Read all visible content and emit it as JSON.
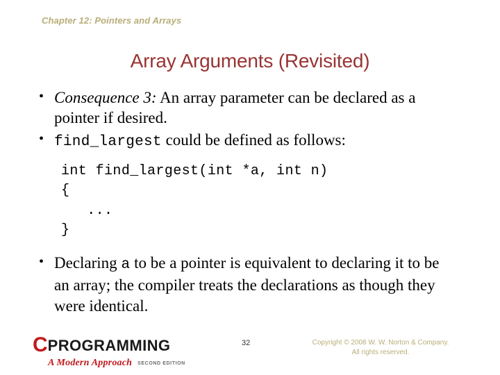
{
  "header": {
    "chapter": "Chapter 12: Pointers and Arrays",
    "chapter_color": "#b8ae78"
  },
  "title": {
    "text": "Array Arguments (Revisited)",
    "color": "#993333"
  },
  "body": {
    "bullet_glyph": "•",
    "bullets": [
      {
        "id": "consequence-3",
        "emphasis": "Consequence 3:",
        "text": " An array parameter can be declared as a pointer if desired."
      },
      {
        "id": "find-largest-intro",
        "code_term": "find_largest",
        "text": " could be defined as follows:"
      },
      {
        "id": "declaring-equivalence",
        "lead": "Declaring ",
        "code_term": "a",
        "text": " to be a pointer is equivalent to declaring it to be an array; the compiler treats the declarations as though they were identical."
      }
    ],
    "code": "int find_largest(int *a, int n)\n{\n   ...\n}"
  },
  "footer": {
    "logo": {
      "letter": "C",
      "word": "PROGRAMMING",
      "tagline": "A Modern Approach",
      "edition": "SECOND EDITION",
      "letter_color": "#c0191b",
      "word_color": "#1a1a1a",
      "tagline_color": "#c0191b"
    },
    "page_number": "32",
    "copyright_line1": "Copyright © 2008 W. W. Norton & Company.",
    "copyright_line2": "All rights reserved.",
    "copyright_color": "#b8ae78"
  }
}
